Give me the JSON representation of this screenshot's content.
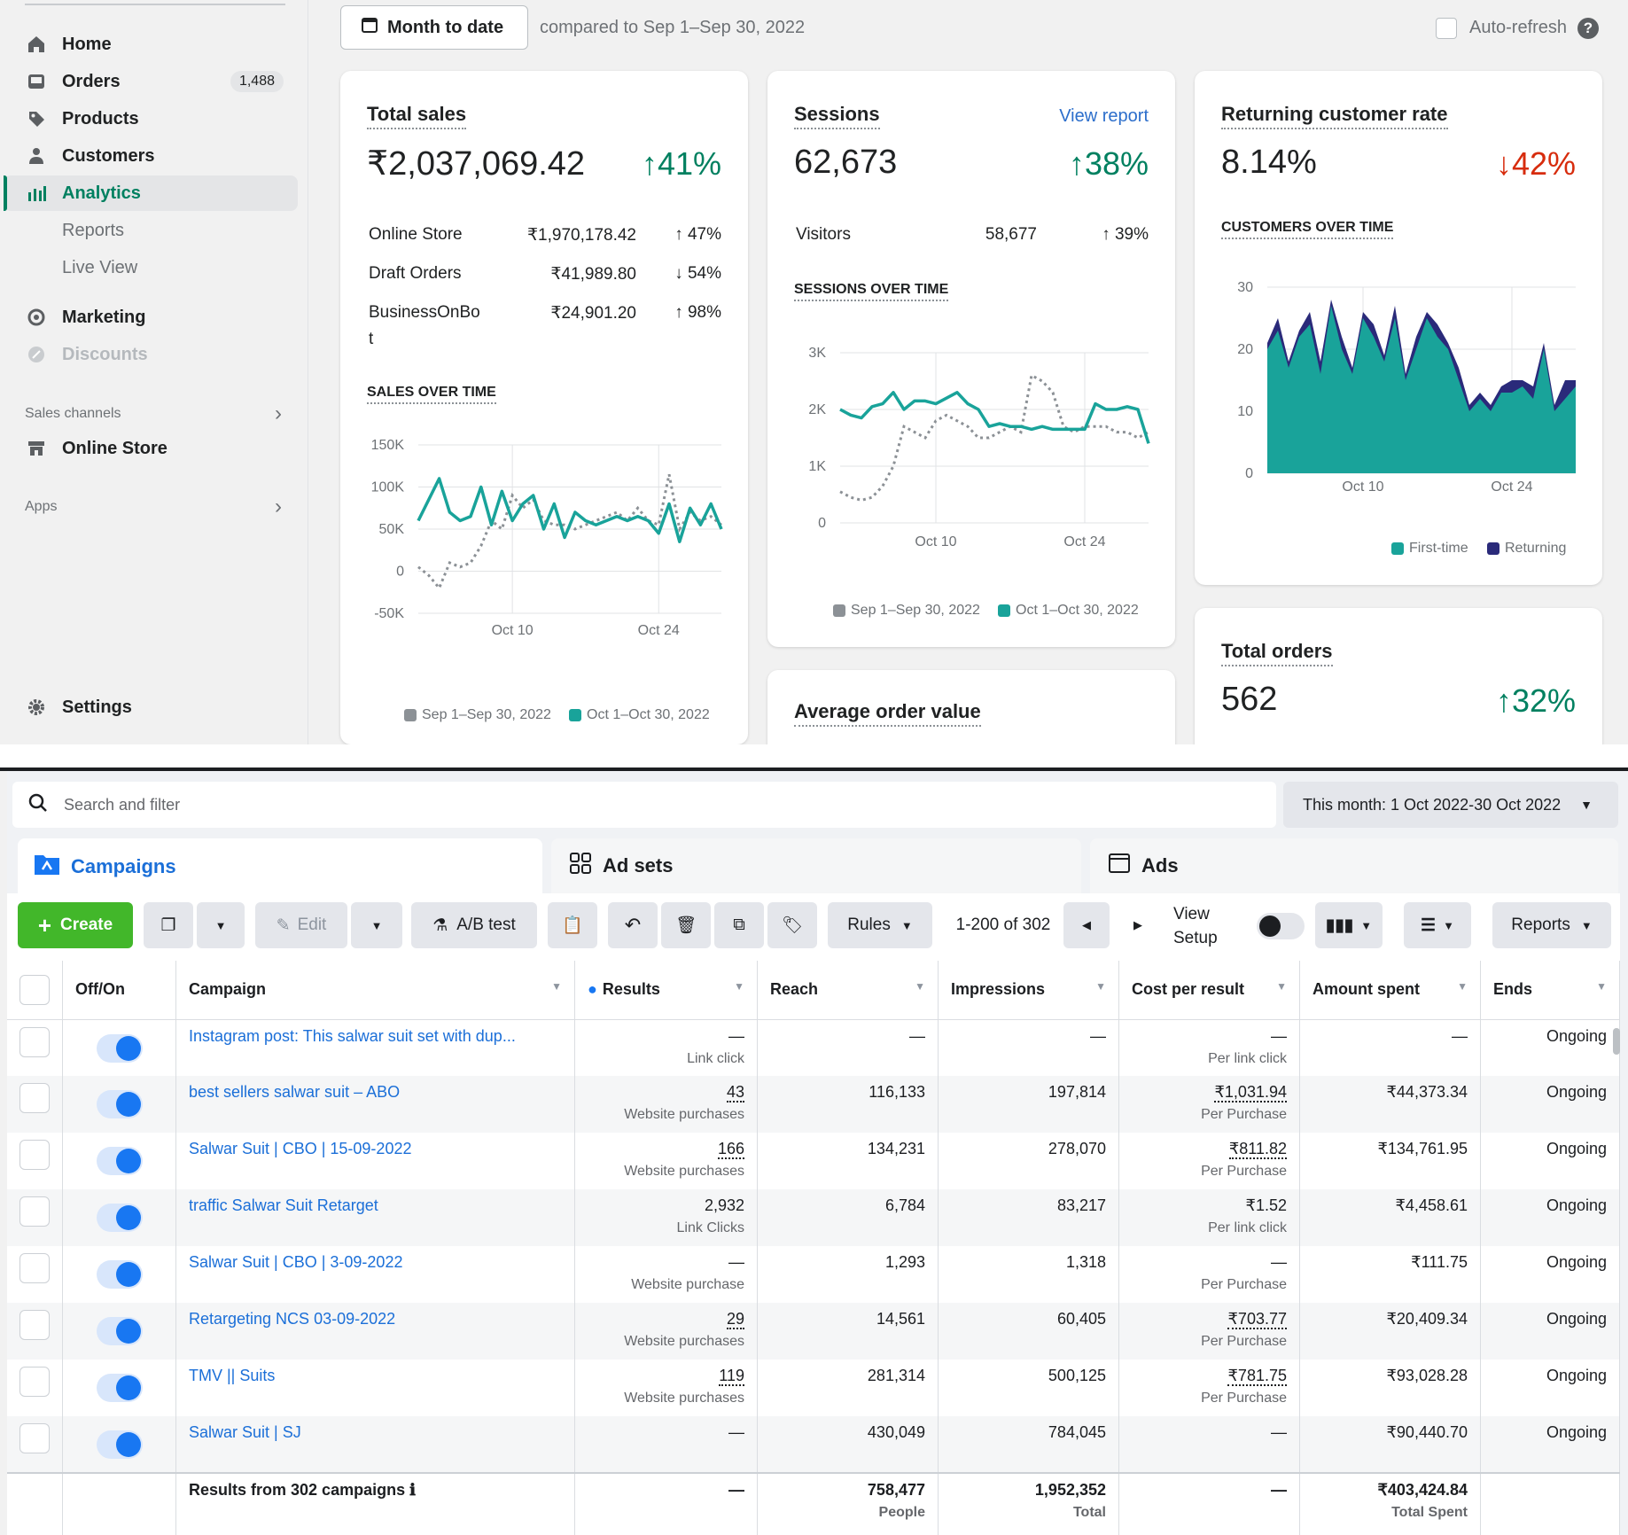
{
  "sidebar": {
    "items": [
      {
        "label": "Home",
        "icon": "home-icon"
      },
      {
        "label": "Orders",
        "icon": "orders-icon",
        "badge": "1,488"
      },
      {
        "label": "Products",
        "icon": "tag-icon"
      },
      {
        "label": "Customers",
        "icon": "person-icon"
      },
      {
        "label": "Analytics",
        "icon": "bar-chart-icon",
        "active": true
      },
      {
        "label": "Reports"
      },
      {
        "label": "Live View"
      },
      {
        "label": "Marketing",
        "icon": "target-icon"
      },
      {
        "label": "Discounts",
        "icon": "discount-icon"
      }
    ],
    "sales_channels": "Sales channels",
    "online_store": "Online Store",
    "apps": "Apps",
    "settings": "Settings"
  },
  "topbar": {
    "date_button": "Month to date",
    "compared": "compared to Sep 1–Sep 30, 2022",
    "auto_refresh": "Auto-refresh"
  },
  "total_sales": {
    "title": "Total sales",
    "value": "₹2,037,069.42",
    "change": "41%",
    "rows": [
      {
        "name": "Online Store",
        "value": "₹1,970,178.42",
        "change": "47%",
        "dir": "up"
      },
      {
        "name": "Draft Orders",
        "value": "₹41,989.80",
        "change": "54%",
        "dir": "down"
      },
      {
        "name": "BusinessOnBo",
        "name2": "t",
        "value": "₹24,901.20",
        "change": "98%",
        "dir": "up"
      }
    ],
    "chart_title": "SALES OVER TIME"
  },
  "sessions": {
    "title": "Sessions",
    "link": "View report",
    "value": "62,673",
    "change": "38%",
    "visitors_label": "Visitors",
    "visitors": "58,677",
    "visitors_change": "39%",
    "chart_title": "SESSIONS OVER TIME"
  },
  "returning": {
    "title": "Returning customer rate",
    "value": "8.14%",
    "change": "42%",
    "chart_title": "CUSTOMERS OVER TIME",
    "legend": [
      "First-time",
      "Returning"
    ]
  },
  "aov": {
    "title": "Average order value"
  },
  "total_orders": {
    "title": "Total orders",
    "value": "562",
    "change": "32%"
  },
  "legend": {
    "prev": "Sep 1–Sep 30, 2022",
    "cur": "Oct 1–Oct 30, 2022"
  },
  "colors": {
    "teal": "#19a39a",
    "gray": "#8c9196",
    "navy": "#2a2a7a",
    "green": "#008060",
    "red": "#d72c0d",
    "fb_blue": "#1877f2",
    "fb_green": "#42b72a"
  },
  "chart_data": [
    {
      "type": "line",
      "title": "SALES OVER TIME",
      "x_ticks": [
        "Oct 10",
        "Oct 24"
      ],
      "y_ticks": [
        "150K",
        "100K",
        "50K",
        "0",
        "-50K"
      ],
      "ylim": [
        -50000,
        150000
      ],
      "series": [
        {
          "name": "Oct 1–Oct 30, 2022",
          "values": [
            60000,
            85000,
            110000,
            70000,
            60000,
            65000,
            100000,
            55000,
            95000,
            60000,
            80000,
            90000,
            50000,
            80000,
            40000,
            70000,
            60000,
            55000,
            60000,
            65000,
            60000,
            65000,
            60000,
            45000,
            80000,
            35000,
            75000,
            55000,
            80000,
            50000
          ]
        },
        {
          "name": "Sep 1–Sep 30, 2022",
          "values": [
            5000,
            -5000,
            -20000,
            10000,
            5000,
            10000,
            30000,
            60000,
            50000,
            90000,
            75000,
            85000,
            60000,
            55000,
            55000,
            50000,
            55000,
            60000,
            65000,
            70000,
            60000,
            75000,
            60000,
            55000,
            115000,
            50000,
            70000,
            60000,
            65000,
            55000
          ]
        }
      ]
    },
    {
      "type": "line",
      "title": "SESSIONS OVER TIME",
      "x_ticks": [
        "Oct 10",
        "Oct 24"
      ],
      "y_ticks": [
        "3K",
        "2K",
        "1K",
        "0"
      ],
      "ylim": [
        0,
        3000
      ],
      "series": [
        {
          "name": "Oct 1–Oct 30, 2022",
          "values": [
            2000,
            1900,
            1850,
            2050,
            2100,
            2300,
            2000,
            2150,
            2150,
            2100,
            2200,
            2300,
            2100,
            2000,
            1700,
            1750,
            1700,
            1700,
            1650,
            1700,
            1650,
            1650,
            1650,
            1650,
            2100,
            2000,
            2000,
            2050,
            2000,
            1400
          ]
        },
        {
          "name": "Sep 1–Sep 30, 2022",
          "values": [
            550,
            450,
            400,
            450,
            650,
            1000,
            1700,
            1600,
            1500,
            1800,
            1900,
            1800,
            1700,
            1500,
            1500,
            1600,
            1700,
            1600,
            2600,
            2500,
            2300,
            1700,
            1600,
            1700,
            1700,
            1700,
            1600,
            1600,
            1500,
            1600
          ]
        }
      ]
    },
    {
      "type": "area",
      "title": "CUSTOMERS OVER TIME",
      "x_ticks": [
        "Oct 10",
        "Oct 24"
      ],
      "y_ticks": [
        "30",
        "20",
        "10",
        "0"
      ],
      "ylim": [
        0,
        30
      ],
      "series": [
        {
          "name": "First-time",
          "values": [
            20,
            23,
            17,
            22,
            24,
            16,
            27,
            20,
            16,
            25,
            22,
            18,
            25,
            15,
            20,
            25,
            22,
            20,
            15,
            10,
            12,
            10,
            13,
            13,
            14,
            12,
            20,
            10,
            12,
            14
          ]
        },
        {
          "name": "Returning",
          "values": [
            1,
            2,
            1,
            1,
            2,
            2,
            1,
            2,
            1,
            1,
            2,
            1,
            2,
            1,
            2,
            1,
            2,
            1,
            2,
            1,
            1,
            1,
            1,
            2,
            1,
            2,
            1,
            1,
            3,
            1
          ]
        }
      ]
    }
  ],
  "fb": {
    "search_placeholder": "Search and filter",
    "date_range": "This month: 1 Oct 2022-30 Oct 2022",
    "tabs": [
      "Campaigns",
      "Ad sets",
      "Ads"
    ],
    "toolbar": {
      "create": "Create",
      "edit": "Edit",
      "ab": "A/B test",
      "rules": "Rules",
      "pagination": "1-200 of 302",
      "view": "View",
      "setup": "Setup",
      "reports": "Reports"
    },
    "headers": [
      "Off/On",
      "Campaign",
      "Results",
      "Reach",
      "Impressions",
      "Cost per result",
      "Amount spent",
      "Ends"
    ],
    "rows": [
      {
        "name": "Instagram post: This salwar suit set with dup...",
        "results": "—",
        "results_sub": "Link click",
        "reach": "—",
        "impressions": "—",
        "cpr": "—",
        "cpr_sub": "Per link click",
        "spent": "—",
        "ends": "Ongoing"
      },
      {
        "name": "best sellers salwar suit – ABO",
        "results": "43",
        "results_sub": "Website purchases",
        "reach": "116,133",
        "impressions": "197,814",
        "cpr": "₹1,031.94",
        "cpr_sub": "Per Purchase",
        "spent": "₹44,373.34",
        "ends": "Ongoing"
      },
      {
        "name": "Salwar Suit | CBO | 15-09-2022",
        "results": "166",
        "results_sub": "Website purchases",
        "reach": "134,231",
        "impressions": "278,070",
        "cpr": "₹811.82",
        "cpr_sub": "Per Purchase",
        "spent": "₹134,761.95",
        "ends": "Ongoing"
      },
      {
        "name": "traffic Salwar Suit Retarget",
        "results": "2,932",
        "results_sub": "Link Clicks",
        "reach": "6,784",
        "impressions": "83,217",
        "cpr": "₹1.52",
        "cpr_sub": "Per link click",
        "spent": "₹4,458.61",
        "ends": "Ongoing"
      },
      {
        "name": "Salwar Suit | CBO | 3-09-2022",
        "results": "—",
        "results_sub": "Website purchase",
        "reach": "1,293",
        "impressions": "1,318",
        "cpr": "—",
        "cpr_sub": "Per Purchase",
        "spent": "₹111.75",
        "ends": "Ongoing"
      },
      {
        "name": "Retargeting NCS 03-09-2022",
        "results": "29",
        "results_sub": "Website purchases",
        "reach": "14,561",
        "impressions": "60,405",
        "cpr": "₹703.77",
        "cpr_sub": "Per Purchase",
        "spent": "₹20,409.34",
        "ends": "Ongoing"
      },
      {
        "name": "TMV || Suits",
        "results": "119",
        "results_sub": "Website purchases",
        "reach": "281,314",
        "impressions": "500,125",
        "cpr": "₹781.75",
        "cpr_sub": "Per Purchase",
        "spent": "₹93,028.28",
        "ends": "Ongoing"
      },
      {
        "name": "Salwar Suit | SJ",
        "results": "—",
        "results_sub": "",
        "reach": "430,049",
        "impressions": "784,045",
        "cpr": "—",
        "cpr_sub": "",
        "spent": "₹90,440.70",
        "ends": "Ongoing"
      }
    ],
    "footer": {
      "label": "Results from 302 campaigns",
      "results": "—",
      "reach": "758,477",
      "reach_sub": "People",
      "impressions": "1,952,352",
      "impressions_sub": "Total",
      "cpr": "—",
      "spent": "₹403,424.84",
      "spent_sub": "Total Spent"
    }
  }
}
